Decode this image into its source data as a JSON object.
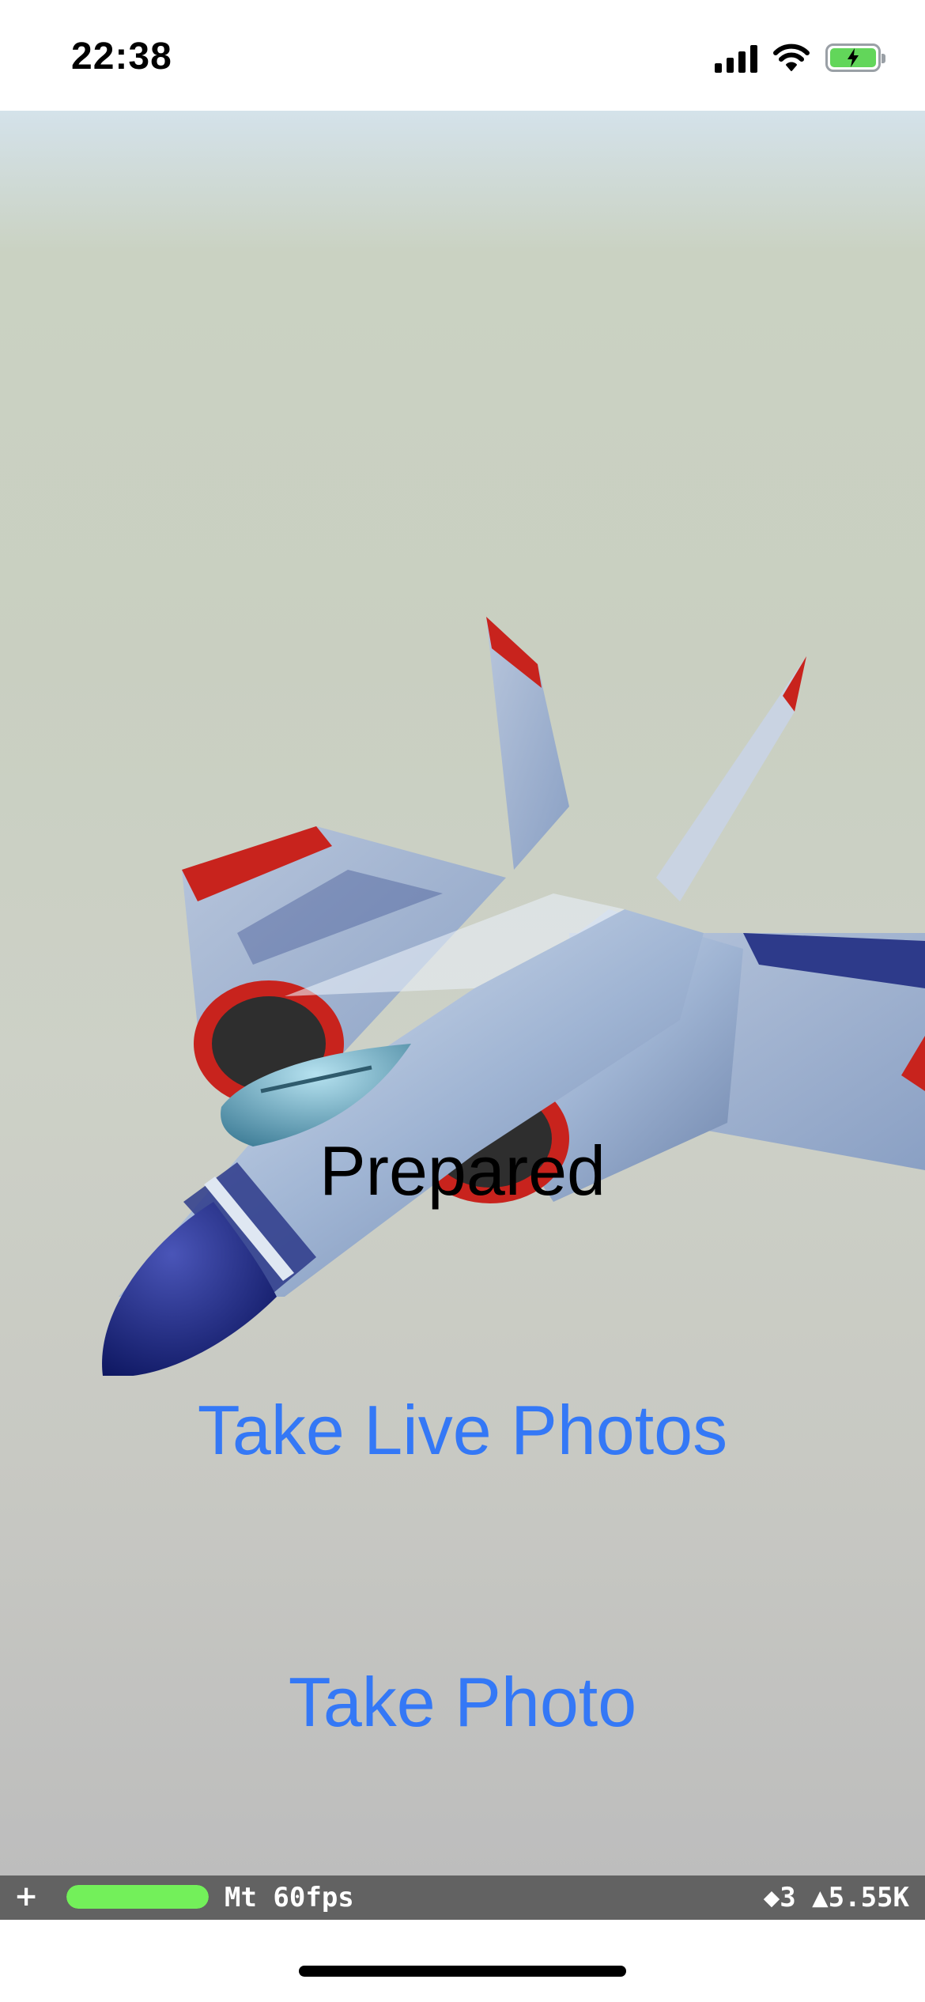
{
  "status_bar": {
    "time": "22:38",
    "icons": [
      "cellular-signal-icon",
      "wifi-icon",
      "battery-charging-icon"
    ],
    "battery_level": 1.0,
    "battery_color": "#62d65a"
  },
  "scene": {
    "model": "jet-airplane",
    "status_text": "Prepared"
  },
  "buttons": {
    "live_photos": "Take Live Photos",
    "photo": "Take Photo",
    "color": "#3478f6"
  },
  "perf_hud": {
    "plus": "+",
    "fps": "Mt 60fps",
    "stats": "◆3 ▲5.55K",
    "meter_level": 1.0,
    "meter_color": "#73f05a"
  }
}
